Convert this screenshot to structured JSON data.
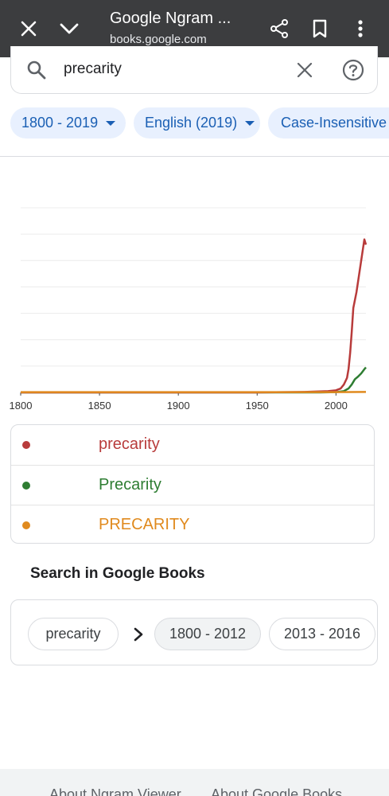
{
  "browser": {
    "title": "Google Ngram ...",
    "url": "books.google.com"
  },
  "search": {
    "query": "precarity"
  },
  "filters": {
    "year_range": "1800 - 2019",
    "corpus": "English (2019)",
    "case": "Case-Insensitive"
  },
  "chart_data": {
    "type": "line",
    "x_ticks": [
      "1800",
      "1850",
      "1900",
      "1950",
      "2000"
    ],
    "xlim": [
      1800,
      2019
    ],
    "ylim": [
      0,
      7
    ],
    "grid": true,
    "series": [
      {
        "name": "precarity",
        "color": "#b83b3b",
        "x": [
          1800,
          1950,
          1980,
          1995,
          2000,
          2003,
          2005,
          2007,
          2008,
          2009,
          2010,
          2011,
          2012,
          2013,
          2014,
          2015,
          2016,
          2017,
          2018,
          2019
        ],
        "y": [
          0,
          0,
          0.02,
          0.05,
          0.08,
          0.15,
          0.3,
          0.55,
          0.9,
          1.5,
          2.3,
          3.2,
          3.5,
          3.8,
          4.2,
          4.6,
          5.0,
          5.4,
          5.8,
          5.6
        ]
      },
      {
        "name": "Precarity",
        "color": "#2e7d32",
        "x": [
          1800,
          1990,
          2000,
          2005,
          2008,
          2010,
          2012,
          2014,
          2016,
          2017,
          2018,
          2019
        ],
        "y": [
          0,
          0,
          0.01,
          0.05,
          0.15,
          0.3,
          0.5,
          0.6,
          0.72,
          0.8,
          0.88,
          0.95
        ]
      },
      {
        "name": "PRECARITY",
        "color": "#e08a1e",
        "x": [
          1800,
          1900,
          1950,
          2000,
          2019
        ],
        "y": [
          0.01,
          0.01,
          0.01,
          0.01,
          0.02
        ]
      }
    ]
  },
  "legend": [
    {
      "label": "precarity",
      "color": "#b83b3b"
    },
    {
      "label": "Precarity",
      "color": "#2e7d32"
    },
    {
      "label": "PRECARITY",
      "color": "#e08a1e"
    }
  ],
  "books": {
    "heading": "Search in Google Books",
    "term": "precarity",
    "ranges": [
      "1800 - 2012",
      "2013 - 2016"
    ]
  },
  "footer": {
    "links": [
      "About Ngram Viewer",
      "About Google Books"
    ]
  }
}
